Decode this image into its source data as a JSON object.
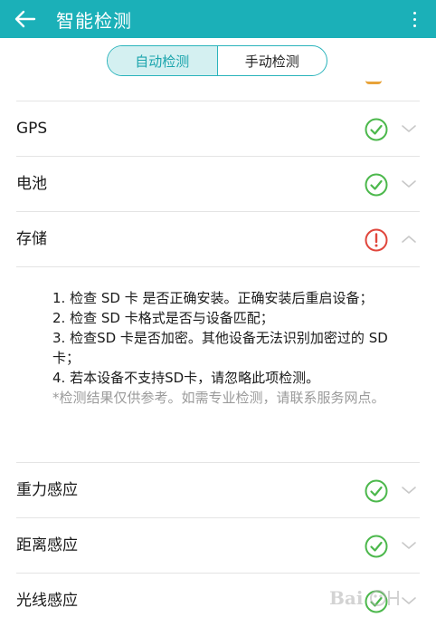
{
  "header": {
    "title": "智能检测"
  },
  "tabs": [
    {
      "label": "自动检测",
      "active": true
    },
    {
      "label": "手动检测",
      "active": false
    }
  ],
  "items": [
    {
      "label": "GPS",
      "status": "ok"
    },
    {
      "label": "电池",
      "status": "ok"
    },
    {
      "label": "存储",
      "status": "warning",
      "expanded": true
    },
    {
      "label": "重力感应",
      "status": "ok"
    },
    {
      "label": "距离感应",
      "status": "ok"
    },
    {
      "label": "光线感应",
      "status": "ok"
    }
  ],
  "storage_detail": {
    "lines": [
      "1. 检查 SD 卡 是否正确安装。正确安装后重启设备；",
      "2. 检查 SD 卡格式是否与设备匹配；",
      "3. 检查SD 卡是否加密。其他设备无法识别加密过的 SD 卡；",
      "4. 若本设备不支持SD卡，请忽略此项检测。"
    ],
    "note": "*检测结果仅供参考。如需专业检测，请联系服务网点。"
  },
  "colors": {
    "accent": "#1bb0b8",
    "ok": "#4cb84c",
    "warning": "#e0463c"
  }
}
